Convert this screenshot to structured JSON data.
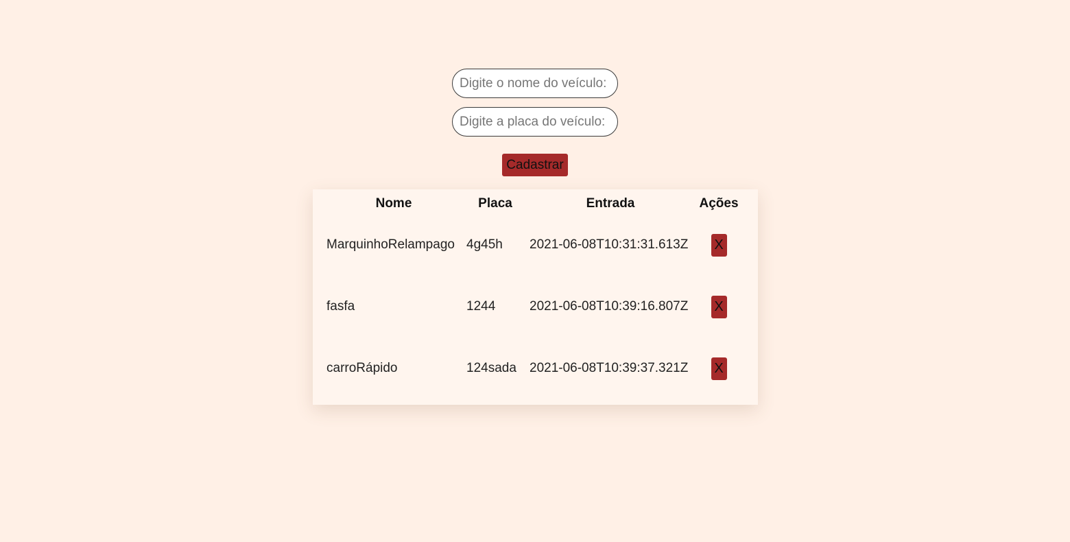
{
  "form": {
    "name_placeholder": "Digite o nome do veículo:",
    "plate_placeholder": "Digite a placa do veículo:",
    "name_value": "",
    "plate_value": "",
    "submit_label": "Cadastrar"
  },
  "table": {
    "headers": [
      "Nome",
      "Placa",
      "Entrada",
      "Ações"
    ],
    "rows": [
      {
        "nome": "MarquinhoRelampago",
        "placa": "4g45h",
        "entrada": "2021-06-08T10:31:31.613Z",
        "action_label": "X"
      },
      {
        "nome": "fasfa",
        "placa": "1244",
        "entrada": "2021-06-08T10:39:16.807Z",
        "action_label": "X"
      },
      {
        "nome": "carroRápido",
        "placa": "124sada",
        "entrada": "2021-06-08T10:39:37.321Z",
        "action_label": "X"
      }
    ]
  },
  "colors": {
    "page_background": "#fff0e6",
    "card_background": "#fff5ee",
    "accent": "#a52a2a"
  }
}
